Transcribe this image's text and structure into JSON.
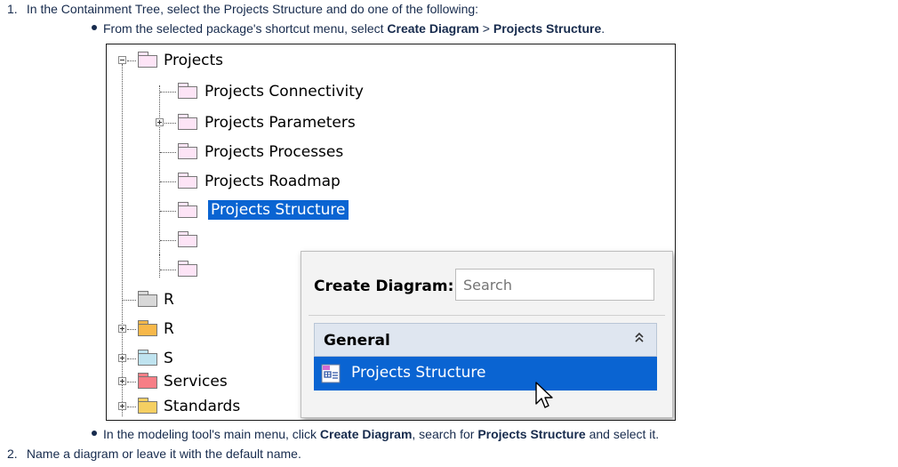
{
  "steps": [
    {
      "number": "1.",
      "text": "In the Containment Tree, select the Projects Structure and do one of the following:"
    },
    {
      "number": "2.",
      "text": "Name a diagram or leave it with the default name."
    }
  ],
  "bullets": [
    {
      "prefix": "From the selected package's shortcut menu, select ",
      "bold1": "Create Diagram",
      "middle": " > ",
      "bold2": "Projects Structure",
      "suffix": "."
    },
    {
      "prefix": "In the modeling tool's main menu, click ",
      "bold1": "Create Diagram",
      "middle": ", search for ",
      "bold2": "Projects Structure",
      "suffix": " and select it."
    }
  ],
  "tree": {
    "root": "Projects",
    "children": [
      "Projects Connectivity",
      "Projects Parameters",
      "Projects Processes",
      "Projects Roadmap",
      "Projects Structure"
    ],
    "siblings_partial": [
      "R",
      "R",
      "S"
    ],
    "siblings": [
      "Services",
      "Standards"
    ]
  },
  "popup": {
    "label": "Create Diagram:",
    "search_placeholder": "Search",
    "group": "General",
    "collapse_glyph": "⌃⌃",
    "item": "Projects Structure"
  },
  "colors": {
    "selection": "#0a64d2",
    "pink_folder": "#fde4f6",
    "gray_folder": "#d8d8d8",
    "orange_folder": "#f7b84a",
    "blue_folder": "#bfe3ef",
    "red_folder": "#f77e86",
    "yellow_folder": "#f5cf62"
  }
}
